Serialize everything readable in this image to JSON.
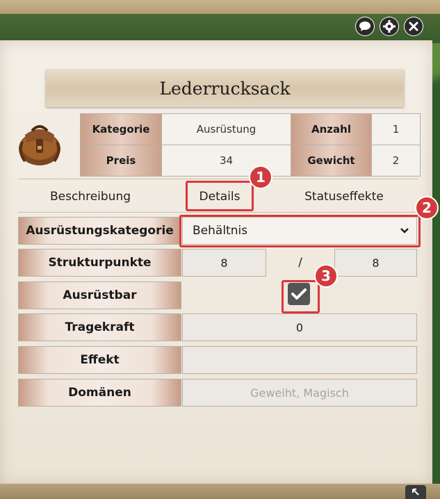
{
  "window": {
    "title": "Lederrucksack"
  },
  "window_buttons": [
    {
      "name": "chat-icon"
    },
    {
      "name": "gear-icon"
    },
    {
      "name": "close-icon"
    }
  ],
  "info": {
    "kategorie_label": "Kategorie",
    "kategorie_value": "Ausrüstung",
    "anzahl_label": "Anzahl",
    "anzahl_value": "1",
    "preis_label": "Preis",
    "preis_value": "34",
    "gewicht_label": "Gewicht",
    "gewicht_value": "2"
  },
  "tabs": [
    {
      "label": "Beschreibung"
    },
    {
      "label": "Details"
    },
    {
      "label": "Statuseffekte"
    }
  ],
  "badges": [
    "1",
    "2",
    "3"
  ],
  "details": {
    "ausruestungskategorie_label": "Ausrüstungskategorie",
    "ausruestungskategorie_value": "Behältnis",
    "strukturpunkte_label": "Strukturpunkte",
    "strukturpunkte_current": "8",
    "strukturpunkte_sep": "/",
    "strukturpunkte_max": "8",
    "ausruestbar_label": "Ausrüstbar",
    "ausruestbar_checked": true,
    "tragekraft_label": "Tragekraft",
    "tragekraft_value": "0",
    "effekt_label": "Effekt",
    "effekt_value": "",
    "domaenen_label": "Domänen",
    "domaenen_value": "Geweiht, Magisch"
  },
  "colors": {
    "highlight": "#d9373b",
    "label_bg": "#c9a08a",
    "sheet_bg": "#f4efe7"
  }
}
